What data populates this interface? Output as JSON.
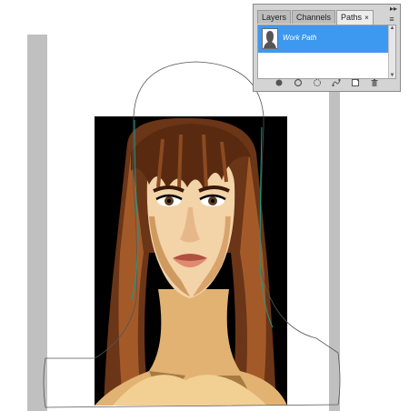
{
  "panel": {
    "tabs": [
      {
        "label": "Layers"
      },
      {
        "label": "Channels"
      },
      {
        "label": "Paths",
        "close": "×"
      }
    ],
    "collapse_glyph": "▸▸",
    "menu_glyph": "≡",
    "paths": [
      {
        "label": "Work Path",
        "selected": true
      }
    ],
    "footer_icons": [
      "fill-path-icon",
      "stroke-path-icon",
      "load-selection-icon",
      "make-work-path-icon",
      "new-path-icon",
      "delete-path-icon"
    ]
  },
  "colors": {
    "selection": "#3d99f0",
    "path_stroke": "#1a9a8a",
    "canvas_gray": "#c0c0c0",
    "panel_bg": "#d4d4d4"
  }
}
